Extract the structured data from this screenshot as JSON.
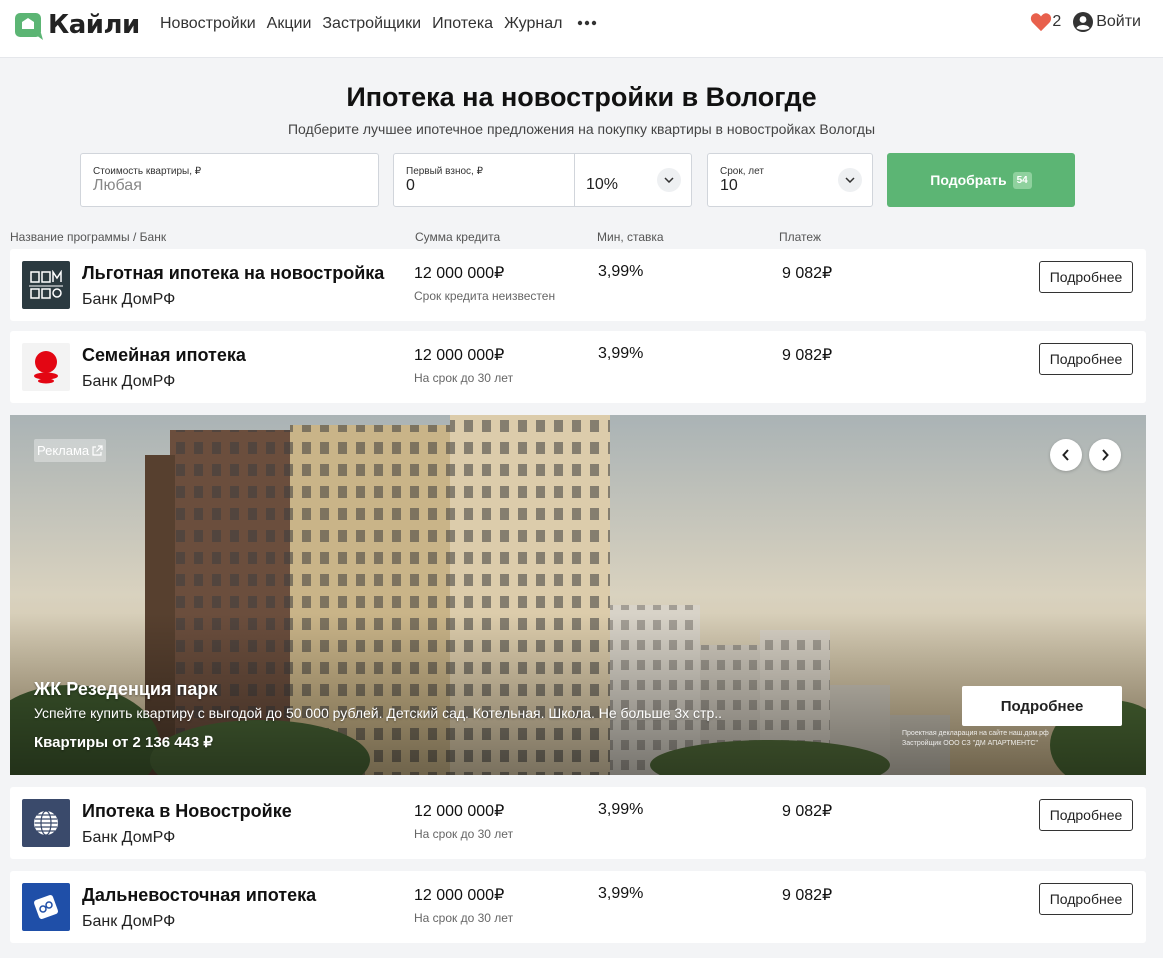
{
  "header": {
    "logo_text": "Кайли",
    "nav": [
      "Новостройки",
      "Акции",
      "Застройщики",
      "Ипотека",
      "Журнал"
    ],
    "favorites_count": "2",
    "login_label": "Войти"
  },
  "hero": {
    "title": "Ипотека на новостройки в Вологде",
    "subtitle": "Подберите лучшее ипотечное предложения на покупку квартиры в новостройках Вологды"
  },
  "filters": {
    "price_label": "Стоимость квартиры, ₽",
    "price_placeholder": "Любая",
    "down_label": "Первый взнос, ₽",
    "down_value": "0",
    "down_percent": "10%",
    "term_label": "Срок, лет",
    "term_value": "10",
    "submit_label": "Подобрать",
    "submit_count": "54"
  },
  "columns": {
    "program": "Название программы / Банк",
    "sum": "Сумма кредита",
    "rate": "Мин, ставка",
    "payment": "Платеж"
  },
  "offers": [
    {
      "program": "Льготная ипотека на новостройка",
      "bank": "Банк ДомРФ",
      "sum": "12 000 000₽",
      "note": "Срок кредита неизвестен",
      "rate": "3,99%",
      "payment": "9 082₽",
      "button": "Подробнее",
      "logo_color": "#2b3a40"
    },
    {
      "program": "Семейная ипотека",
      "bank": "Банк ДомРФ",
      "sum": "12 000 000₽",
      "note": "На срок до 30 лет",
      "rate": "3,99%",
      "payment": "9 082₽",
      "button": "Подробнее",
      "logo_color": "#e30613"
    },
    {
      "program": "Ипотека в Новострое­йке",
      "bank": "Банк ДомРФ",
      "sum": "12 000 000₽",
      "note": "На срок до 30 лет",
      "rate": "3,99%",
      "payment": "9 082₽",
      "button": "Подробнее",
      "logo_color": "#3a4a6b"
    },
    {
      "program": "Дальневосточная ипотека",
      "bank": "Банк ДомРФ",
      "sum": "12 000 000₽",
      "note": "На срок до 30 лет",
      "rate": "3,99%",
      "payment": "9 082₽",
      "button": "Подробнее",
      "logo_color": "#1f4fa8"
    }
  ],
  "banner": {
    "ad_label": "Реклама",
    "title": "ЖК Резеденция парк",
    "description": "Успейте купить квартиру с выгодой до 50 000 рублей. Детский сад. Котельная. Школа. Не больше 3х стр..",
    "price": "Квартиры от 2 136 443 ₽",
    "button": "Подробнее",
    "note_line1": "Проектная декларация на сайте наш.дом.рф",
    "note_line2": "Застройщик ООО СЗ \"ДМ АПАРТМЕНТС\""
  },
  "colors": {
    "accent": "#5cb574",
    "heart": "#e8604c"
  }
}
